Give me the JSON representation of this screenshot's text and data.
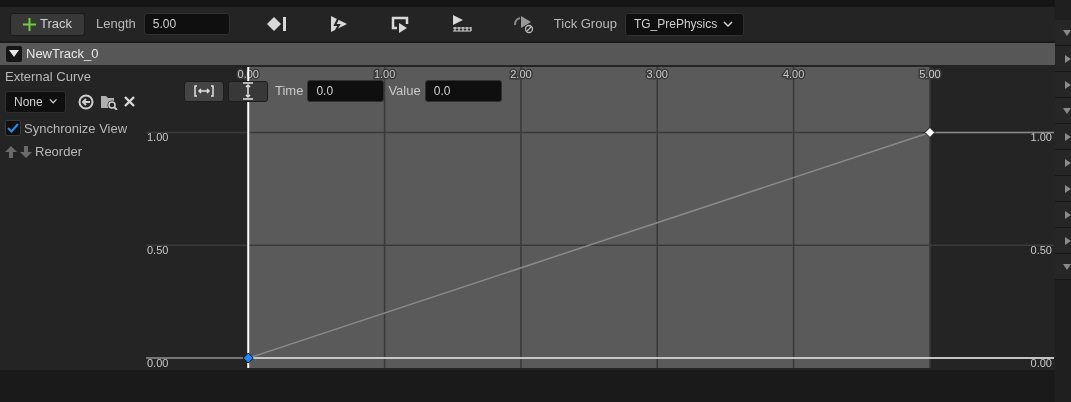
{
  "toolbar": {
    "add_button": "Track",
    "length_label": "Length",
    "length": "5.00",
    "tick_group_label": "Tick Group",
    "tick_group": "TG_PrePhysics"
  },
  "track": {
    "name": "NewTrack_0",
    "expanded": true,
    "external_curve_label": "External Curve",
    "external_curve": "None",
    "synchronize_view": {
      "label": "Synchronize View",
      "checked": true
    },
    "reorder_label": "Reorder",
    "key_editor": {
      "time_label": "Time",
      "time": "0.0",
      "value_label": "Value",
      "value": "0.0"
    },
    "keys": [
      {
        "selected": true
      },
      {
        "selected": false
      }
    ],
    "chart_data": {
      "type": "line",
      "x": [
        -0.75,
        0,
        5,
        5.91
      ],
      "series": [
        {
          "color": "#8a8a8a",
          "marker": "diamond",
          "values": [
            0,
            0,
            1,
            1
          ]
        }
      ],
      "bands": [
        {
          "axis": "x",
          "from": 0,
          "to": 5,
          "color": "#5a5a5a"
        }
      ],
      "ref_lines": [
        {
          "axis": "x",
          "value": 0,
          "color": "#ffffff"
        }
      ],
      "grid": true,
      "xlim": [
        -0.75,
        5.91
      ],
      "ylim": [
        -0.044,
        1.29
      ],
      "xticks": [
        {
          "value": 0,
          "label": "0.00"
        },
        {
          "value": 1,
          "label": "1.00"
        },
        {
          "value": 2,
          "label": "2.00"
        },
        {
          "value": 3,
          "label": "3.00"
        },
        {
          "value": 4,
          "label": "4.00"
        },
        {
          "value": 5,
          "label": "5.00"
        }
      ],
      "yticks": [
        {
          "value": 0,
          "label": "0.00"
        },
        {
          "value": 0.5,
          "label": "0.50"
        },
        {
          "value": 1,
          "label": "1.00"
        }
      ]
    }
  },
  "side_rows": [
    {
      "expanded": true
    },
    {
      "expanded": false
    },
    {
      "expanded": false
    },
    {
      "expanded": true
    },
    {
      "expanded": false
    },
    {
      "expanded": false
    },
    {
      "expanded": false
    },
    {
      "expanded": false
    },
    {
      "expanded": false
    },
    {
      "expanded": true
    }
  ]
}
